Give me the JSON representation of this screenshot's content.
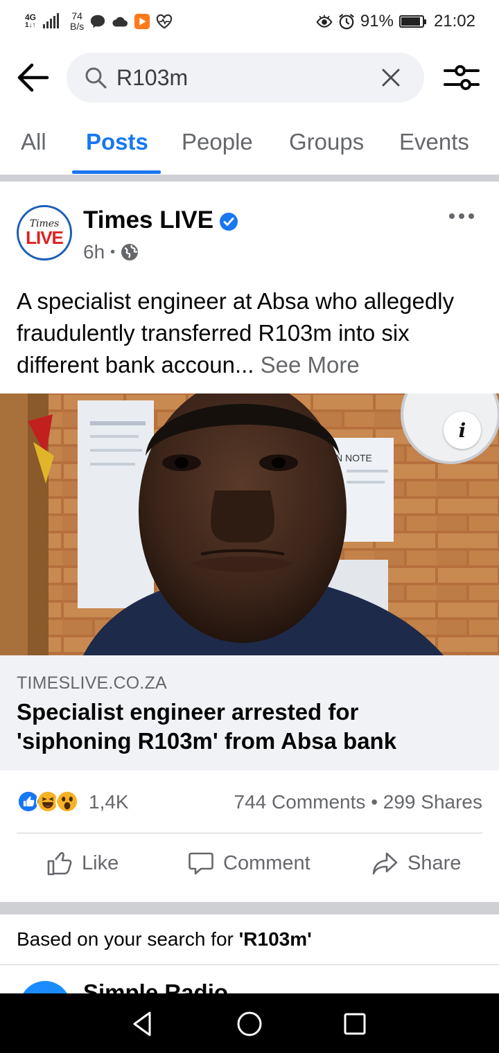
{
  "status_bar": {
    "network_type": "4G",
    "network_sub": "1↓↑",
    "speed_value": "74",
    "speed_unit": "B/s",
    "battery_percent": "91%",
    "battery_level": 0.91,
    "time": "21:02"
  },
  "search": {
    "query": "R103m"
  },
  "tabs": [
    {
      "label": "All",
      "active": false
    },
    {
      "label": "Posts",
      "active": true
    },
    {
      "label": "People",
      "active": false
    },
    {
      "label": "Groups",
      "active": false
    },
    {
      "label": "Events",
      "active": false
    }
  ],
  "post": {
    "avatar_line1": "Times",
    "avatar_line2": "LIVE",
    "page_name": "Times LIVE",
    "time_ago": "6h",
    "separator": "•",
    "text": "A specialist engineer at Absa who allegedly fraudulently transferred R103m into six different bank accoun...",
    "see_more": "See More",
    "photo_sign_text": "N NOTE",
    "info_label": "i",
    "link": {
      "domain": "TIMESLIVE.CO.ZA",
      "title": "Specialist engineer arrested for 'siphoning R103m' from Absa bank"
    },
    "reaction_count": "1,4K",
    "comments": "744 Comments",
    "engagement_separator": "•",
    "shares": "299 Shares",
    "actions": {
      "like": "Like",
      "comment": "Comment",
      "share": "Share"
    }
  },
  "suggestion": {
    "prefix": "Based on your search for ",
    "query_quoted": "'R103m'"
  },
  "next_result": {
    "name": "Simple Radio"
  },
  "colors": {
    "accent": "#1877f2",
    "secondary_text": "#65676b",
    "divider": "#ced0d4"
  }
}
